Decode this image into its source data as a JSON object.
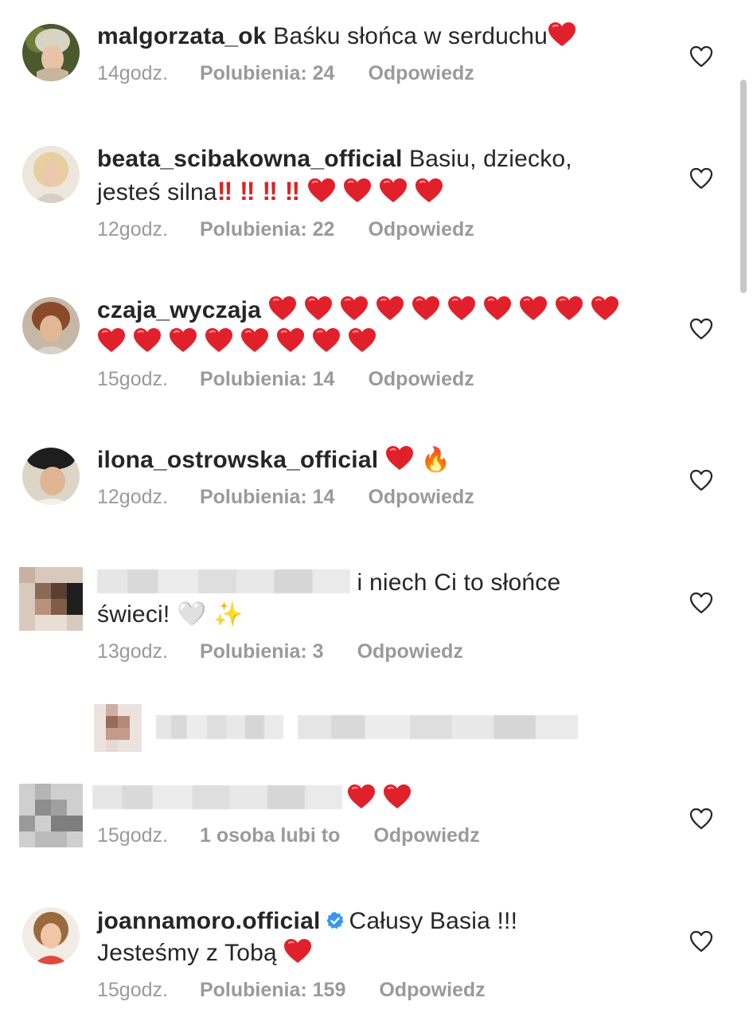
{
  "comments": [
    {
      "username": "malgorzata_ok",
      "text": "Baśku słońca w serduchu",
      "time": "14godz.",
      "likes": "Polubienia: 24",
      "reply": "Odpowiedz"
    },
    {
      "username": "beata_scibakowna_official",
      "text": "Basiu, dziecko,",
      "text2": "jesteś silna",
      "exclaim": "‼",
      "time": "12godz.",
      "likes": "Polubienia: 22",
      "reply": "Odpowiedz"
    },
    {
      "username": "czaja_wyczaja",
      "time": "15godz.",
      "likes": "Polubienia: 14",
      "reply": "Odpowiedz"
    },
    {
      "username": "ilona_ostrowska_official",
      "fire": "🔥",
      "time": "12godz.",
      "likes": "Polubienia: 14",
      "reply": "Odpowiedz"
    },
    {
      "text": "i niech Ci to słońce",
      "text2": "świeci!",
      "emoji_white_heart": "🤍",
      "emoji_sparkles": "✨",
      "time": "13godz.",
      "likes": "Polubienia: 3",
      "reply": "Odpowiedz"
    },
    {
      "time": "15godz.",
      "likes": "1 osoba lubi to",
      "reply": "Odpowiedz"
    },
    {
      "username": "joannamoro.official",
      "text": "Całusy Basia !!!",
      "text2": "Jesteśmy z Tobą",
      "time": "15godz.",
      "likes": "Polubienia: 159",
      "reply": "Odpowiedz"
    }
  ],
  "icons": {
    "heart": "red-heart-icon",
    "like": "heart-outline-icon",
    "verified": "verified-badge-icon"
  },
  "colors": {
    "heart": "#e0212b",
    "meta": "#9a9a9a",
    "text": "#262626",
    "verified": "#3897f0"
  }
}
